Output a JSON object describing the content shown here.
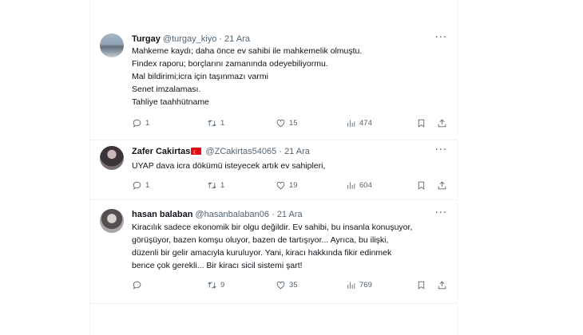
{
  "tweets": [
    {
      "name": "Turgay",
      "handle": "@turgay_kiyo",
      "separator": "·",
      "date": "21 Ara",
      "flag": false,
      "lines": [
        "Mahkeme kaydı; daha önce ev sahibi ile mahkemelik olmuştu.",
        "Findex raporu; borçlarını zamanında odeyebiliyormu.",
        "Mal bildirimi;icra için taşınmazı varmi",
        "Senet imzalaması.",
        "Tahliye taahhütname"
      ],
      "replies": "1",
      "retweets": "1",
      "likes": "15",
      "views": "474"
    },
    {
      "name": "Zafer Cakirtas",
      "handle": "@ZCakirtas54065",
      "separator": "·",
      "date": "21 Ara",
      "flag": true,
      "lines": [
        "UYAP dava icra dökümü isteyecek artık ev sahipleri,"
      ],
      "replies": "1",
      "retweets": "1",
      "likes": "19",
      "views": "604"
    },
    {
      "name": "hasan balaban",
      "handle": "@hasanbalaban06",
      "separator": "·",
      "date": "21 Ara",
      "flag": false,
      "lines": [
        "Kiracılık sadece ekonomik bir olgu değildir. Ev sahibi, bu insanla konuşuyor,",
        "görüşüyor, bazen komşu oluyor, bazen de tartışıyor... Ayrıca, bu ilişki,",
        "düzenli bir gelir amacıyla kuruluyor. Yani, kiracı hakkında fikir edinmek",
        "bence çok gerekli... Bir kiracı sicil sistemi şart!"
      ],
      "replies": "",
      "retweets": "9",
      "likes": "35",
      "views": "769"
    }
  ],
  "icons": {
    "more": "more-icon",
    "reply": "reply-icon",
    "retweet": "retweet-icon",
    "like": "heart-icon",
    "views": "views-icon",
    "bookmark": "bookmark-icon",
    "share": "share-icon",
    "flag": "turkey-flag-icon"
  },
  "colors": {
    "text": "#0f1419",
    "secondary": "#536471",
    "divider": "#eff3f4",
    "flag": "#e30a17"
  },
  "more_glyph": "···"
}
